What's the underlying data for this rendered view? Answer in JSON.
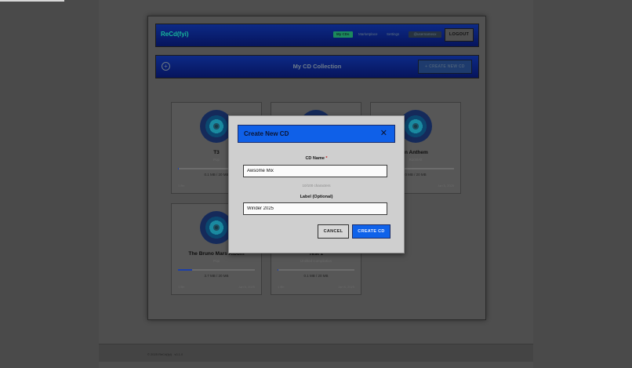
{
  "app": {
    "brand": "ReCd(fyi)",
    "nav": {
      "my_cds": "My CDs",
      "marketplace": "Marketplace",
      "settings": "Settings",
      "user": "@usernamexx",
      "logout": "LOGOUT"
    }
  },
  "collection": {
    "title": "My CD Collection",
    "create_button": "+ CREATE NEW CD",
    "cards": [
      {
        "title": "T3",
        "subtitle": "Pop",
        "size": "0.1 MB / 20 MB",
        "progress": 0.005,
        "left": "1 file",
        "right": "Jan 5, 2025"
      },
      {
        "title": "",
        "subtitle": "",
        "size": "",
        "progress": 0,
        "left": "",
        "right": ""
      },
      {
        "title": "in Anthem",
        "subtitle": "Rock/Alt",
        "size": "0 MB / 20 MB",
        "progress": 0,
        "left": "",
        "right": "Jan 5, 2025"
      },
      {
        "title": "The Bruno Mars Album",
        "subtitle": "Pop",
        "size": "3.7 MB / 20 MB",
        "progress": 0.18,
        "left": "1 file",
        "right": "Jan 5, 2025"
      },
      {
        "title": "Test 1",
        "subtitle": "Untitled Compilation",
        "size": "0.1 MB / 20 MB",
        "progress": 0.005,
        "left": "1 file",
        "right": "Jan 5, 2025"
      }
    ]
  },
  "footer": {
    "copyright": "© 2025 ReCd(fyi)",
    "version": "v0.1.0"
  },
  "modal": {
    "title": "Create New CD",
    "close_icon": "close-icon",
    "name_label": "CD Name",
    "required_mark": "*",
    "name_value": "Awsome Mix",
    "name_hint": "10/100 characters",
    "label_label": "Label (Optional)",
    "label_value": "Winder 2025",
    "cancel": "CANCEL",
    "create": "CREATE CD"
  },
  "colors": {
    "nav_bg": "#0d2a86",
    "accent": "#0f60e8",
    "brand_text": "#18b59a",
    "overlay": "#4a4a4a"
  }
}
